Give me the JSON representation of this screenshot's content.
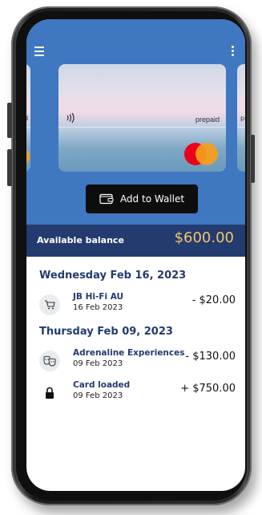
{
  "header": {
    "menu_icon": "hamburger-menu-icon",
    "more_icon": "more-vertical-icon"
  },
  "cards": {
    "main": {
      "type_label": "prepaid",
      "brand": "mastercard"
    },
    "left_peek_text": "aid",
    "right_peek_text": "pr"
  },
  "wallet_button": {
    "label": "Add to Wallet"
  },
  "balance": {
    "label": "Available balance",
    "amount": "$600.00"
  },
  "transactions": [
    {
      "date_header": "Wednesday Feb 16, 2023",
      "items": [
        {
          "icon": "shopping-cart-icon",
          "title": "JB Hi-Fi AU",
          "date": "16 Feb 2023",
          "amount": "- $20.00"
        }
      ]
    },
    {
      "date_header": "Thursday Feb 09, 2023",
      "items": [
        {
          "icon": "theatre-masks-icon",
          "title": "Adrenaline Experiences",
          "date": "09 Feb 2023",
          "amount": "- $130.00"
        },
        {
          "icon": "lock-icon",
          "title": "Card loaded",
          "date": "09 Feb 2023",
          "amount": "+ $750.00"
        }
      ]
    }
  ],
  "colors": {
    "header_blue": "#3f77c1",
    "balance_bar": "#233b6e",
    "balance_amount": "#f2c56d",
    "mastercard_red": "#eb001b",
    "mastercard_orange": "#f79e1b"
  }
}
